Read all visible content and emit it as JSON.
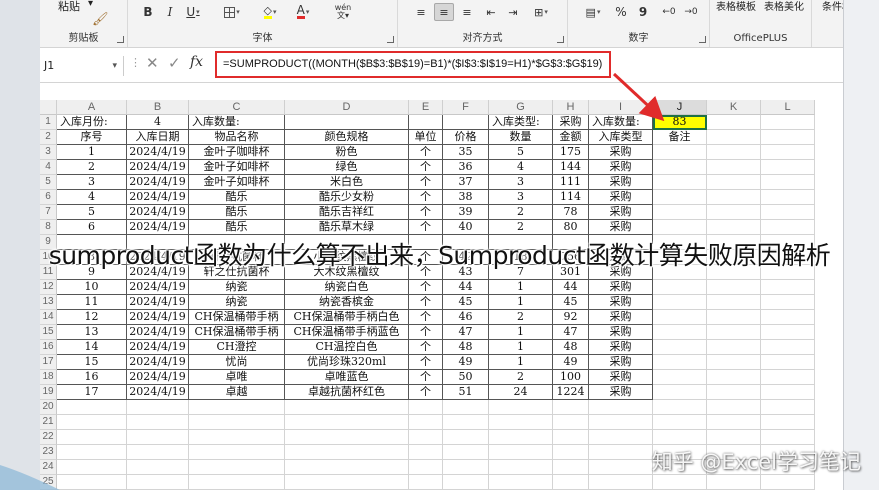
{
  "ribbon": {
    "clipboard": {
      "label": "剪贴板",
      "paste": "粘贴"
    },
    "font": {
      "label": "字体",
      "bold": "B",
      "italic": "I",
      "underline": "U",
      "font_color_glyph": "A",
      "pinyin": "wén"
    },
    "alignment": {
      "label": "对齐方式"
    },
    "number": {
      "label": "数字",
      "percent": "%",
      "comma": "9"
    },
    "officeplus": {
      "label": "OfficePLUS",
      "table_template": "表格模板",
      "table_beautify": "表格美化"
    },
    "conditional_format": "条件格式"
  },
  "formula_bar": {
    "name_box": "J1",
    "fx": "fx",
    "formula": "=SUMPRODUCT((MONTH($B$3:$B$19)=B1)*($I$3:$I$19=H1)*$G$3:$G$19)"
  },
  "columns": [
    "A",
    "B",
    "C",
    "D",
    "E",
    "F",
    "G",
    "H",
    "I",
    "J",
    "K",
    "L"
  ],
  "rows": [
    {
      "n": "1",
      "cells": [
        "入库月份:",
        "4",
        "入库数量:",
        "",
        "",
        "",
        "入库类型:",
        "采购",
        "入库数量:",
        "83",
        "",
        ""
      ]
    },
    {
      "n": "2",
      "cells": [
        "序号",
        "入库日期",
        "物品名称",
        "颜色规格",
        "单位",
        "价格",
        "数量",
        "金额",
        "入库类型",
        "备注",
        "",
        ""
      ]
    },
    {
      "n": "3",
      "cells": [
        "1",
        "2024/4/19",
        "金叶子咖啡杯",
        "粉色",
        "个",
        "35",
        "5",
        "175",
        "采购",
        "",
        "",
        ""
      ]
    },
    {
      "n": "4",
      "cells": [
        "2",
        "2024/4/19",
        "金叶子如啡杯",
        "绿色",
        "个",
        "36",
        "4",
        "144",
        "采购",
        "",
        "",
        ""
      ]
    },
    {
      "n": "5",
      "cells": [
        "3",
        "2024/4/19",
        "金叶子如啡杯",
        "米白色",
        "个",
        "37",
        "3",
        "111",
        "采购",
        "",
        "",
        ""
      ]
    },
    {
      "n": "6",
      "cells": [
        "4",
        "2024/4/19",
        "酷乐",
        "酷乐少女粉",
        "个",
        "38",
        "3",
        "114",
        "采购",
        "",
        "",
        ""
      ]
    },
    {
      "n": "7",
      "cells": [
        "5",
        "2024/4/19",
        "酷乐",
        "酷乐吉祥红",
        "个",
        "39",
        "2",
        "78",
        "采购",
        "",
        "",
        ""
      ]
    },
    {
      "n": "8",
      "cells": [
        "6",
        "2024/4/19",
        "酷乐",
        "酷乐草木绿",
        "个",
        "40",
        "2",
        "80",
        "采购",
        "",
        "",
        ""
      ]
    },
    {
      "n": "9",
      "cells": [
        "",
        "",
        "",
        "",
        "",
        "",
        "",
        "",
        "",
        "",
        "",
        ""
      ]
    },
    {
      "n": "10",
      "cells": [
        "8",
        "2024/4/19",
        "轩尚抗菌杯",
        "小木纹黑檀纹",
        "个",
        "42",
        "18",
        "756",
        "采购",
        "",
        "",
        ""
      ]
    },
    {
      "n": "11",
      "cells": [
        "9",
        "2024/4/19",
        "轩之仕抗菌杯",
        "大木纹黑檀纹",
        "个",
        "43",
        "7",
        "301",
        "采购",
        "",
        "",
        ""
      ]
    },
    {
      "n": "12",
      "cells": [
        "10",
        "2024/4/19",
        "纳瓷",
        "纳瓷白色",
        "个",
        "44",
        "1",
        "44",
        "采购",
        "",
        "",
        ""
      ]
    },
    {
      "n": "13",
      "cells": [
        "11",
        "2024/4/19",
        "纳瓷",
        "纳瓷香槟金",
        "个",
        "45",
        "1",
        "45",
        "采购",
        "",
        "",
        ""
      ]
    },
    {
      "n": "14",
      "cells": [
        "12",
        "2024/4/19",
        "CH保温桶带手柄",
        "CH保温桶带手柄白色",
        "个",
        "46",
        "2",
        "92",
        "采购",
        "",
        "",
        ""
      ]
    },
    {
      "n": "15",
      "cells": [
        "13",
        "2024/4/19",
        "CH保温桶带手柄",
        "CH保温桶带手柄蓝色",
        "个",
        "47",
        "1",
        "47",
        "采购",
        "",
        "",
        ""
      ]
    },
    {
      "n": "16",
      "cells": [
        "14",
        "2024/4/19",
        "CH澄控",
        "CH温控白色",
        "个",
        "48",
        "1",
        "48",
        "采购",
        "",
        "",
        ""
      ]
    },
    {
      "n": "17",
      "cells": [
        "15",
        "2024/4/19",
        "忧尚",
        "优尚珍珠320ml",
        "个",
        "49",
        "1",
        "49",
        "采购",
        "",
        "",
        ""
      ]
    },
    {
      "n": "18",
      "cells": [
        "16",
        "2024/4/19",
        "卓唯",
        "卓唯蓝色",
        "个",
        "50",
        "2",
        "100",
        "采购",
        "",
        "",
        ""
      ]
    },
    {
      "n": "19",
      "cells": [
        "17",
        "2024/4/19",
        "卓越",
        "卓越抗菌杯红色",
        "个",
        "51",
        "24",
        "1224",
        "采购",
        "",
        "",
        ""
      ]
    },
    {
      "n": "20",
      "cells": [
        "",
        "",
        "",
        "",
        "",
        "",
        "",
        "",
        "",
        "",
        "",
        ""
      ]
    },
    {
      "n": "21",
      "cells": [
        "",
        "",
        "",
        "",
        "",
        "",
        "",
        "",
        "",
        "",
        "",
        ""
      ]
    },
    {
      "n": "22",
      "cells": [
        "",
        "",
        "",
        "",
        "",
        "",
        "",
        "",
        "",
        "",
        "",
        ""
      ]
    },
    {
      "n": "23",
      "cells": [
        "",
        "",
        "",
        "",
        "",
        "",
        "",
        "",
        "",
        "",
        "",
        ""
      ]
    },
    {
      "n": "24",
      "cells": [
        "",
        "",
        "",
        "",
        "",
        "",
        "",
        "",
        "",
        "",
        "",
        ""
      ]
    },
    {
      "n": "25",
      "cells": [
        "",
        "",
        "",
        "",
        "",
        "",
        "",
        "",
        "",
        "",
        "",
        ""
      ]
    }
  ],
  "selected_cell": "J1",
  "highlight_color": "#ffff00",
  "accent_red": "#e02b2b",
  "caption": "sumproduct函数为什么算不出来，Sumproduct函数计算失败原因解析",
  "watermark": "知乎 @Excel学习笔记"
}
